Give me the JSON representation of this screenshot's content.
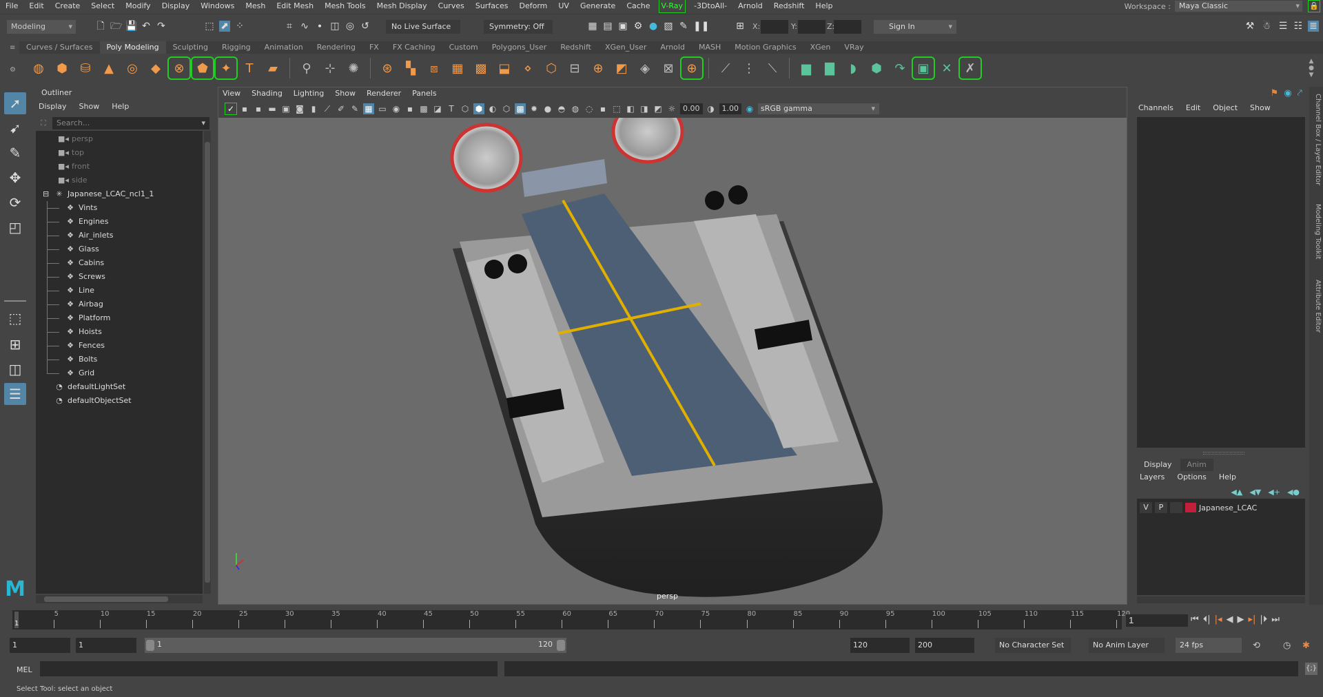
{
  "menubar": {
    "items": [
      "File",
      "Edit",
      "Create",
      "Select",
      "Modify",
      "Display",
      "Windows",
      "Mesh",
      "Edit Mesh",
      "Mesh Tools",
      "Mesh Display",
      "Curves",
      "Surfaces",
      "Deform",
      "UV",
      "Generate",
      "Cache",
      "V-Ray",
      "-3DtoAll-",
      "Arnold",
      "Redshift",
      "Help"
    ],
    "workspace_label": "Workspace :",
    "workspace_value": "Maya Classic"
  },
  "statusline": {
    "mode": "Modeling",
    "live_surface": "No Live Surface",
    "symmetry": "Symmetry: Off",
    "coord_labels": [
      "X:",
      "Y:",
      "Z:"
    ],
    "sign_in": "Sign In"
  },
  "shelf": {
    "tabs": [
      "Curves / Surfaces",
      "Poly Modeling",
      "Sculpting",
      "Rigging",
      "Animation",
      "Rendering",
      "FX",
      "FX Caching",
      "Custom",
      "Polygons_User",
      "Redshift",
      "XGen_User",
      "Arnold",
      "MASH",
      "Motion Graphics",
      "XGen",
      "VRay"
    ],
    "active_tab": "Poly Modeling"
  },
  "outliner": {
    "title": "Outliner",
    "menu": [
      "Display",
      "Show",
      "Help"
    ],
    "search_placeholder": "Search...",
    "cameras": [
      "persp",
      "top",
      "front",
      "side"
    ],
    "root": "Japanese_LCAC_ncl1_1",
    "children": [
      "Vints",
      "Engines",
      "Air_inlets",
      "Glass",
      "Cabins",
      "Screws",
      "Line",
      "Airbag",
      "Platform",
      "Hoists",
      "Fences",
      "Bolts",
      "Grid"
    ],
    "sets": [
      "defaultLightSet",
      "defaultObjectSet"
    ]
  },
  "viewport": {
    "menu": [
      "View",
      "Shading",
      "Lighting",
      "Show",
      "Renderer",
      "Panels"
    ],
    "exposure": "0.00",
    "gamma": "1.00",
    "color_space": "sRGB gamma",
    "camera_label": "persp"
  },
  "channelbox": {
    "menu": [
      "Channels",
      "Edit",
      "Object",
      "Show"
    ],
    "side_tabs": [
      "Channel Box / Layer Editor",
      "Modeling Toolkit",
      "Attribute Editor"
    ]
  },
  "layer_editor": {
    "tabs": [
      "Display",
      "Anim"
    ],
    "active_tab": "Display",
    "menu": [
      "Layers",
      "Options",
      "Help"
    ],
    "layers": [
      {
        "v": "V",
        "p": "P",
        "name": "Japanese_LCAC",
        "color": "#c0203a"
      }
    ]
  },
  "timeline": {
    "ticks": [
      5,
      10,
      15,
      20,
      25,
      30,
      35,
      40,
      45,
      50,
      55,
      60,
      65,
      70,
      75,
      80,
      85,
      90,
      95,
      100,
      105,
      110,
      115,
      120
    ],
    "range_min": 1,
    "range_max": 120,
    "current_frame_marker": "1",
    "current_frame": "1"
  },
  "rangebar": {
    "start_min": "1",
    "start": "1",
    "slider_start": "1",
    "slider_end": "120",
    "end": "120",
    "end_max": "200",
    "character_set": "No Character Set",
    "anim_layer": "No Anim Layer",
    "fps": "24 fps"
  },
  "cmdline": {
    "label": "MEL"
  },
  "helpline": {
    "text": "Select Tool: select an object"
  }
}
